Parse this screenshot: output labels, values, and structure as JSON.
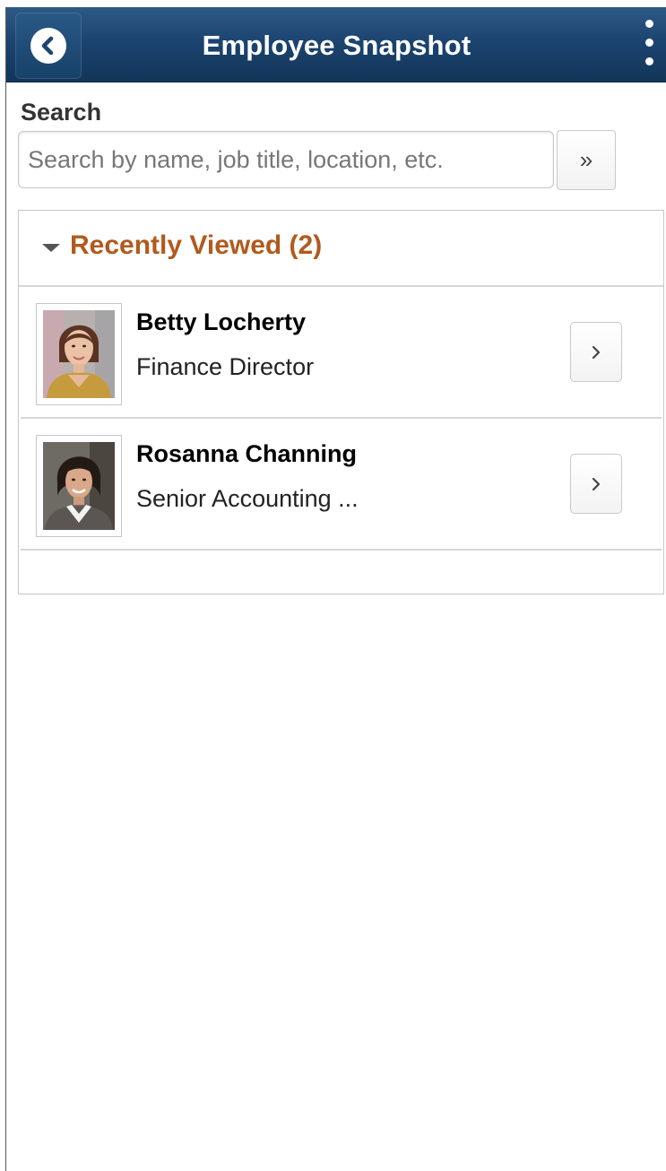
{
  "header": {
    "title": "Employee Snapshot",
    "back_icon": "back-chevron-icon",
    "menu_icon": "vertical-dots-icon",
    "bar_color": "#1c4470"
  },
  "search": {
    "label": "Search",
    "placeholder": "Search by name, job title, location, etc.",
    "value": "",
    "go_label": "»"
  },
  "recently_viewed": {
    "title": "Recently Viewed (2)",
    "title_color": "#b15a1e",
    "employees": [
      {
        "name": "Betty Locherty",
        "job_title": "Finance Director"
      },
      {
        "name": "Rosanna Channing",
        "job_title": "Senior Accounting ..."
      }
    ]
  }
}
